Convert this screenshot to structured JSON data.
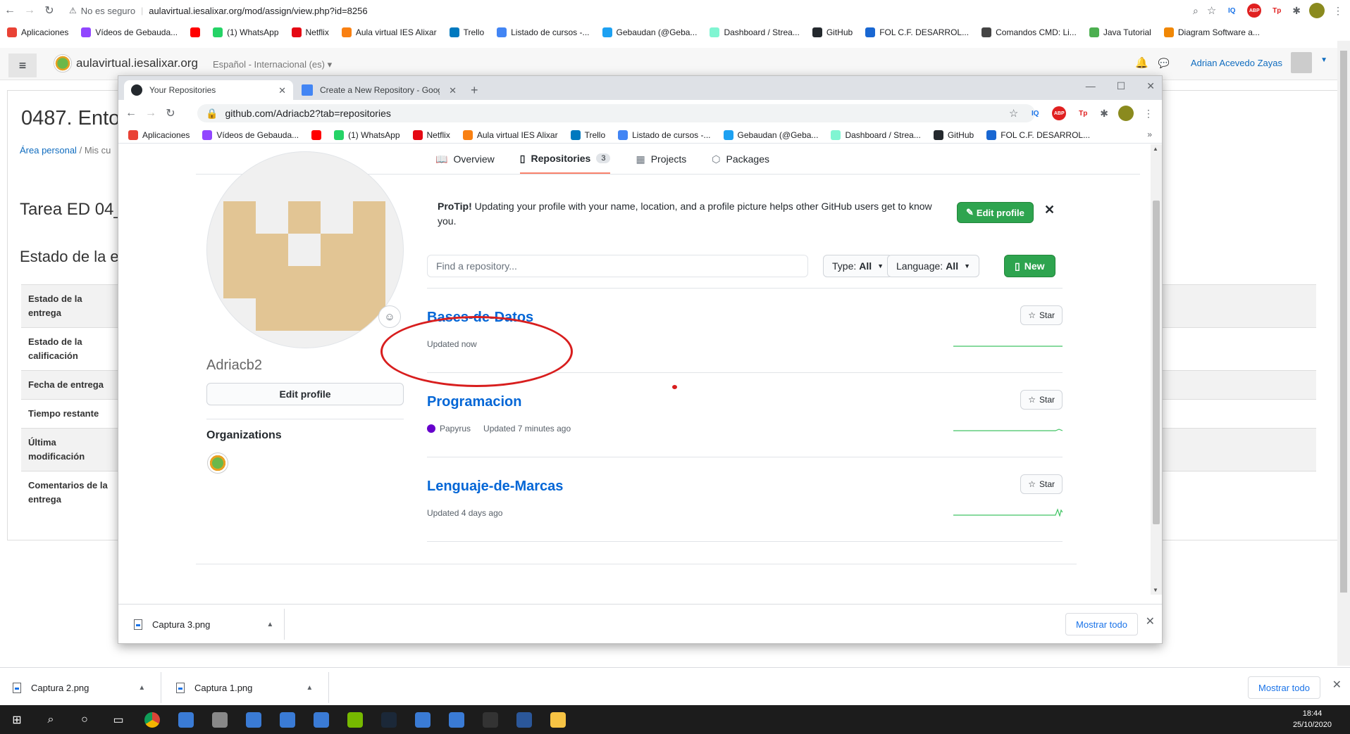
{
  "outer_browser": {
    "insecure_label": "No es seguro",
    "url": "aulavirtual.iesalixar.org/mod/assign/view.php?id=8256",
    "bookmarks": [
      {
        "label": "Aplicaciones",
        "icon": "apps-grid-icon",
        "color": "#e94235"
      },
      {
        "label": "Vídeos de Gebauda...",
        "icon": "twitch-icon",
        "color": "#9146ff"
      },
      {
        "label": "",
        "icon": "youtube-icon",
        "color": "#ff0000"
      },
      {
        "label": "(1) WhatsApp",
        "icon": "whatsapp-icon",
        "color": "#25d366"
      },
      {
        "label": "Netflix",
        "icon": "netflix-icon",
        "color": "#e50914"
      },
      {
        "label": "Aula virtual IES Alixar",
        "icon": "moodle-icon",
        "color": "#f98012"
      },
      {
        "label": "Trello",
        "icon": "trello-icon",
        "color": "#0079bf"
      },
      {
        "label": "Listado de cursos -...",
        "icon": "google-icon",
        "color": "#4285f4"
      },
      {
        "label": "Gebaudan (@Geba...",
        "icon": "twitter-icon",
        "color": "#1da1f2"
      },
      {
        "label": "Dashboard / Strea...",
        "icon": "streamlabs-icon",
        "color": "#80f5d2"
      },
      {
        "label": "GitHub",
        "icon": "github-icon",
        "color": "#24292e"
      },
      {
        "label": "FOL C.F. DESARROL...",
        "icon": "classroom-icon",
        "color": "#1967d2"
      },
      {
        "label": "Comandos CMD: Li...",
        "icon": "cmd-icon",
        "color": "#444444"
      },
      {
        "label": "Java Tutorial",
        "icon": "w3-icon",
        "color": "#4caf50"
      },
      {
        "label": "Diagram Software a...",
        "icon": "diagram-icon",
        "color": "#f08705"
      }
    ]
  },
  "moodle": {
    "site_name": "aulavirtual.iesalixar.org",
    "language": "Español - Internacional (es)",
    "user_name": "Adrian Acevedo Zayas",
    "course_title": "0487. Ento",
    "breadcrumb": [
      "Área personal",
      "Mis cu"
    ],
    "task_title": "Tarea ED 04_",
    "section_title": "Estado de la e",
    "table_labels": [
      "Estado de la entrega",
      "Estado de la calificación",
      "Fecha de entrega",
      "Tiempo restante",
      "Última modificación",
      "Comentarios de la entrega"
    ]
  },
  "popup": {
    "tabs": [
      {
        "title": "Your Repositories",
        "icon": "github-icon"
      },
      {
        "title": "Create a New Repository - Googl",
        "icon": "google-docs-icon"
      }
    ],
    "url": "github.com/Adriacb2?tab=repositories",
    "bookmarks": [
      {
        "label": "Aplicaciones",
        "color": "#e94235"
      },
      {
        "label": "Vídeos de Gebauda...",
        "color": "#9146ff"
      },
      {
        "label": "",
        "color": "#ff0000"
      },
      {
        "label": "(1) WhatsApp",
        "color": "#25d366"
      },
      {
        "label": "Netflix",
        "color": "#e50914"
      },
      {
        "label": "Aula virtual IES Alixar",
        "color": "#f98012"
      },
      {
        "label": "Trello",
        "color": "#0079bf"
      },
      {
        "label": "Listado de cursos -...",
        "color": "#4285f4"
      },
      {
        "label": "Gebaudan (@Geba...",
        "color": "#1da1f2"
      },
      {
        "label": "Dashboard / Strea...",
        "color": "#80f5d2"
      },
      {
        "label": "GitHub",
        "color": "#24292e"
      },
      {
        "label": "FOL C.F. DESARROL...",
        "color": "#1967d2"
      }
    ],
    "download": {
      "file": "Captura 3.png",
      "show_all": "Mostrar todo"
    }
  },
  "github": {
    "nav_tabs": [
      {
        "label": "Overview",
        "icon": "book-icon"
      },
      {
        "label": "Repositories",
        "icon": "repo-icon",
        "count": "3"
      },
      {
        "label": "Projects",
        "icon": "project-icon"
      },
      {
        "label": "Packages",
        "icon": "package-icon"
      }
    ],
    "username": "Adriacb2",
    "edit_profile": "Edit profile",
    "organizations_title": "Organizations",
    "protip_bold": "ProTip!",
    "protip_text": " Updating your profile with your name, location, and a profile picture helps other GitHub users get to know you.",
    "protip_button": "Edit profile",
    "search_placeholder": "Find a repository...",
    "type_label": "Type:",
    "type_value": "All",
    "language_label": "Language:",
    "language_value": "All",
    "new_button": "New",
    "repos": [
      {
        "name": "Bases-de-Datos",
        "language": "",
        "language_color": "",
        "updated": "Updated now",
        "star": "Star"
      },
      {
        "name": "Programacion",
        "language": "Papyrus",
        "language_color": "#6600cc",
        "updated": "Updated 7 minutes ago",
        "star": "Star"
      },
      {
        "name": "Lenguaje-de-Marcas",
        "language": "",
        "language_color": "",
        "updated": "Updated 4 days ago",
        "star": "Star"
      }
    ],
    "accent_green": "#2ea44f",
    "link_blue": "#0366d6",
    "annotation_color": "#d81e1e"
  },
  "outer_downloads": [
    {
      "file": "Captura 2.png"
    },
    {
      "file": "Captura 1.png"
    }
  ],
  "outer_show_all": "Mostrar todo",
  "taskbar": {
    "icons": [
      "windows-start-icon",
      "search-icon",
      "cortana-icon",
      "task-view-icon",
      "chrome-icon",
      "app-icon",
      "steam-alt-icon",
      "explorer-icon",
      "app-icon",
      "app-icon",
      "nvidia-icon",
      "steam-icon",
      "app-icon",
      "app-icon",
      "terminal-icon",
      "word-icon",
      "folder-icon"
    ],
    "time": "18:44",
    "date": "25/10/2020"
  }
}
